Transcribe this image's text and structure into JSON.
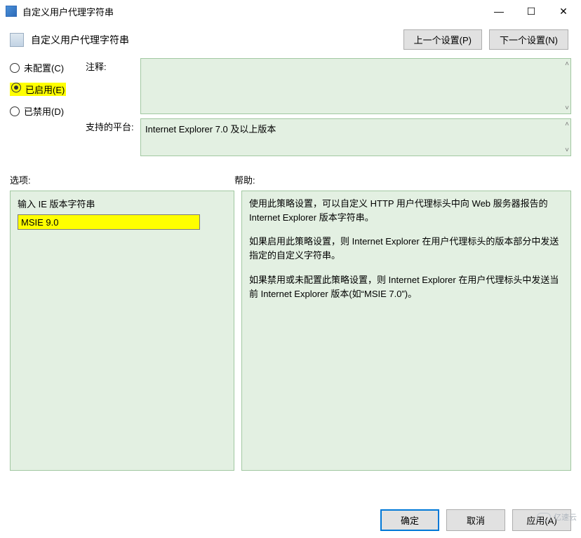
{
  "window": {
    "title": "自定义用户代理字符串"
  },
  "header": {
    "section_title": "自定义用户代理字符串",
    "prev_setting": "上一个设置(P)",
    "next_setting": "下一个设置(N)"
  },
  "config": {
    "not_configured": "未配置(C)",
    "enabled": "已启用(E)",
    "disabled": "已禁用(D)",
    "comment_label": "注释:",
    "comment_value": "",
    "platform_label": "支持的平台:",
    "platform_value": "Internet Explorer 7.0 及以上版本"
  },
  "sections": {
    "options_label": "选项:",
    "help_label": "帮助:"
  },
  "options": {
    "ie_version_label": "输入 IE 版本字符串",
    "ie_version_value": "MSIE 9.0"
  },
  "help": {
    "p1": "使用此策略设置，可以自定义 HTTP 用户代理标头中向 Web 服务器报告的 Internet Explorer 版本字符串。",
    "p2": "如果启用此策略设置，则 Internet Explorer 在用户代理标头的版本部分中发送指定的自定义字符串。",
    "p3": "如果禁用或未配置此策略设置，则 Internet Explorer 在用户代理标头中发送当前 Internet Explorer 版本(如“MSIE 7.0”)。"
  },
  "buttons": {
    "ok": "确定",
    "cancel": "取消",
    "apply": "应用(A)"
  },
  "watermark": "亿速云"
}
